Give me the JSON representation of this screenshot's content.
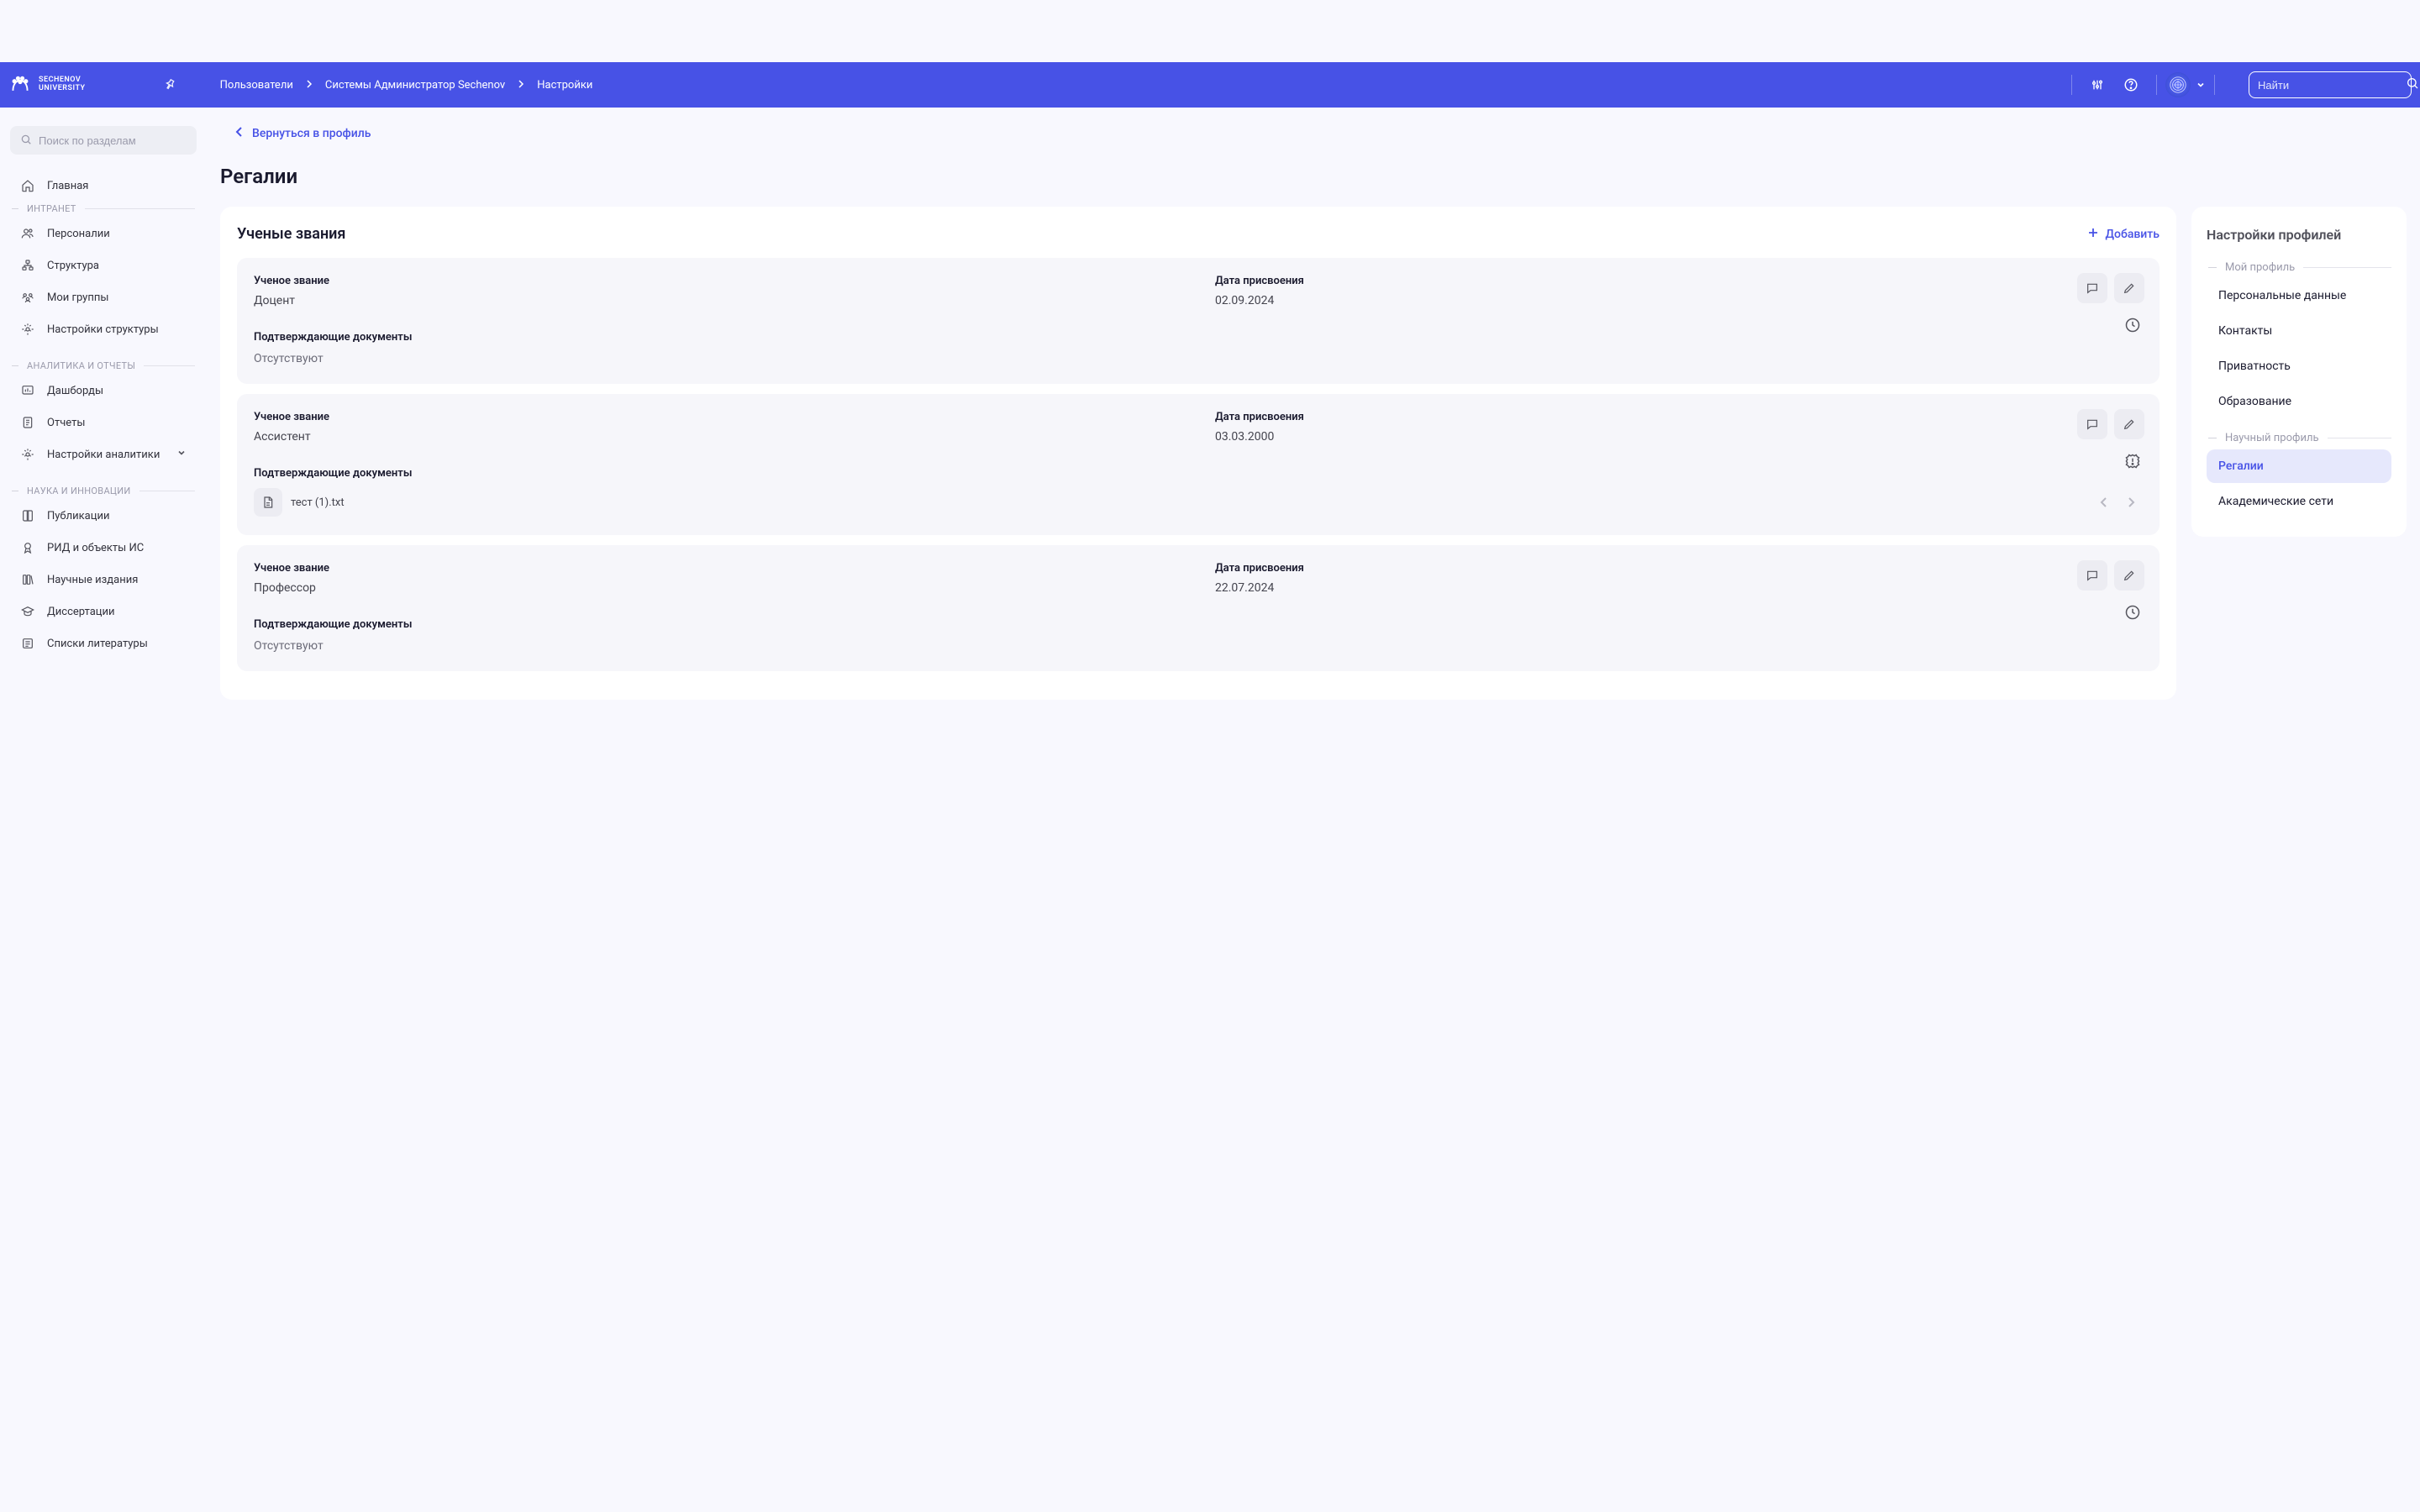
{
  "logo_text": "SECHENOV\nUNIVERSITY",
  "breadcrumb": [
    "Пользователи",
    "Системы Администратор Sechenov",
    "Настройки"
  ],
  "global_search_placeholder": "Найти",
  "side_search_placeholder": "Поиск по разделам",
  "sidebar": {
    "home": "Главная",
    "intranet_label": "ИНТРАНЕТ",
    "intranet_items": [
      "Персоналии",
      "Структура",
      "Мои группы",
      "Настройки структуры"
    ],
    "analytics_label": "АНАЛИТИКА И ОТЧЕТЫ",
    "analytics_items": [
      "Дашборды",
      "Отчеты",
      "Настройки аналитики"
    ],
    "science_label": "НАУКА И ИННОВАЦИИ",
    "science_items": [
      "Публикации",
      "РИД и объекты ИС",
      "Научные издания",
      "Диссертации",
      "Списки литературы"
    ]
  },
  "back_link": "Вернуться в профиль",
  "page_title": "Регалии",
  "panel": {
    "title": "Ученые звания",
    "add_label": "Добавить",
    "docs_label": "Подтверждающие документы",
    "docs_empty": "Отсутствуют",
    "field_title": "Ученое звание",
    "field_date": "Дата присвоения"
  },
  "cards": [
    {
      "title": "Доцент",
      "date": "02.09.2024",
      "docs": [],
      "status": "pending"
    },
    {
      "title": "Ассистент",
      "date": "03.03.2000",
      "docs": [
        "тест (1).txt"
      ],
      "status": "warning"
    },
    {
      "title": "Профессор",
      "date": "22.07.2024",
      "docs": [],
      "status": "pending"
    }
  ],
  "right": {
    "title": "Настройки профилей",
    "sec1_label": "Мой профиль",
    "sec1_items": [
      "Персональные данные",
      "Контакты",
      "Приватность",
      "Образование"
    ],
    "sec2_label": "Научный профиль",
    "sec2_items": [
      "Регалии",
      "Академические сети"
    ],
    "active": "Регалии"
  }
}
